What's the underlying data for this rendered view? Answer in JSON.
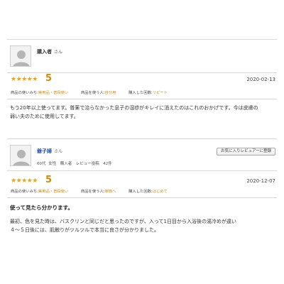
{
  "reviews": [
    {
      "reviewer_name": "購入者",
      "honorific": "さん",
      "rating_stars": "★★★★★",
      "rating_value": 5,
      "score": "5",
      "date": "2020-02-13",
      "tags": [
        {
          "label": "商品の使いみち:",
          "value": "実用品・普段使い"
        },
        {
          "label": "商品を使う人:",
          "value": "自分用"
        },
        {
          "label": "購入した回数:",
          "value": "リピート"
        }
      ],
      "body_lines": [
        "もう20年以上使ってます。普薬で治らなかった息子の湿疹がキレイに消えたのはこれのおかげです。今は皮膚の",
        "弱い夫のために使用してます。"
      ]
    },
    {
      "reviewer_name": "爺子婦",
      "honorific": "さん",
      "meta": "60代 女性　購入者　レビュー投稿　42件",
      "favorite_button": "お気に入りレビュアーに登録",
      "rating_stars": "★★★★★",
      "rating_value": 5,
      "score": "5",
      "date": "2020-12-07",
      "tags": [
        {
          "label": "商品の使いみち:",
          "value": "実用品・普段使い"
        },
        {
          "label": "商品を使う人:",
          "value": "家族へ"
        },
        {
          "label": "購入した回数:",
          "value": "はじめて"
        }
      ],
      "title": "使って見たら分かります。",
      "body_lines": [
        "最初、色を見た時は、バスクリンと同じだと思ったのですが、入って1日目から入浴後の湯冷めが違い",
        "４～５日後には、肌触りがツルツルで本当に良さが分かりました。"
      ]
    }
  ],
  "colors": {
    "star": "#f2a20a",
    "accent": "#d98900",
    "link": "#1f4fa8"
  },
  "icons": {
    "avatar": "user-silhouette-icon"
  }
}
